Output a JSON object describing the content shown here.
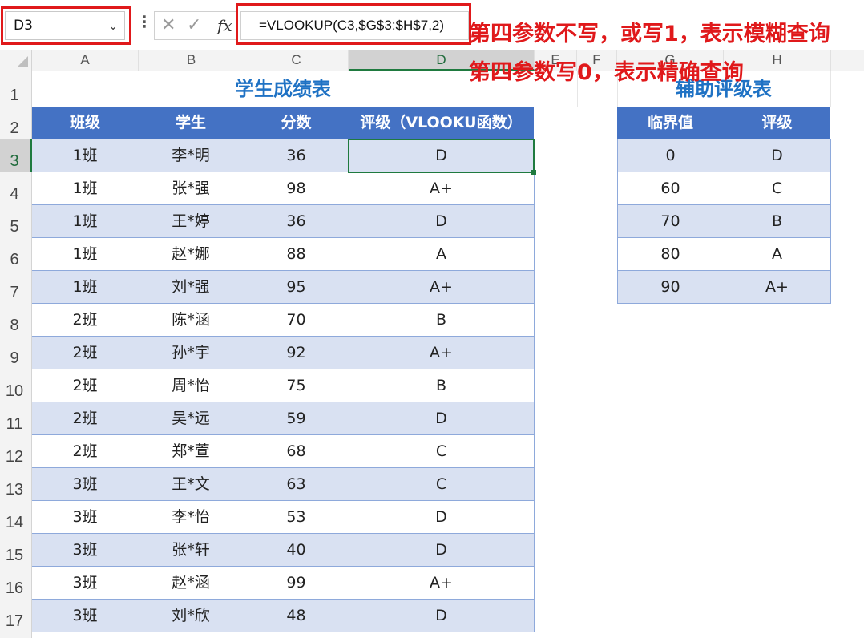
{
  "formula_bar": {
    "name_box": "D3",
    "formula": "=VLOOKUP(C3,$G$3:$H$7,2)",
    "fx_label": "fx"
  },
  "annotations": {
    "note1": "第四参数不写，或写1，表示模糊查询",
    "note2": "第四参数写0，表示精确查询"
  },
  "columns": [
    "A",
    "B",
    "C",
    "D",
    "E",
    "F",
    "G",
    "H"
  ],
  "rows": [
    "1",
    "2",
    "3",
    "4",
    "5",
    "6",
    "7",
    "8",
    "9",
    "10",
    "11",
    "12",
    "13",
    "14",
    "15",
    "16",
    "17"
  ],
  "score_table": {
    "title": "学生成绩表",
    "headers": [
      "班级",
      "学生",
      "分数",
      "评级（VLOOKU函数）"
    ],
    "rows": [
      [
        "1班",
        "李*明",
        "36",
        "D"
      ],
      [
        "1班",
        "张*强",
        "98",
        "A+"
      ],
      [
        "1班",
        "王*婷",
        "36",
        "D"
      ],
      [
        "1班",
        "赵*娜",
        "88",
        "A"
      ],
      [
        "1班",
        "刘*强",
        "95",
        "A+"
      ],
      [
        "2班",
        "陈*涵",
        "70",
        "B"
      ],
      [
        "2班",
        "孙*宇",
        "92",
        "A+"
      ],
      [
        "2班",
        "周*怡",
        "75",
        "B"
      ],
      [
        "2班",
        "吴*远",
        "59",
        "D"
      ],
      [
        "2班",
        "郑*萱",
        "68",
        "C"
      ],
      [
        "3班",
        "王*文",
        "63",
        "C"
      ],
      [
        "3班",
        "李*怡",
        "53",
        "D"
      ],
      [
        "3班",
        "张*轩",
        "40",
        "D"
      ],
      [
        "3班",
        "赵*涵",
        "99",
        "A+"
      ],
      [
        "3班",
        "刘*欣",
        "48",
        "D"
      ]
    ]
  },
  "grade_table": {
    "title": "辅助评级表",
    "headers": [
      "临界值",
      "评级"
    ],
    "rows": [
      [
        "0",
        "D"
      ],
      [
        "60",
        "C"
      ],
      [
        "70",
        "B"
      ],
      [
        "80",
        "A"
      ],
      [
        "90",
        "A+"
      ]
    ]
  },
  "colors": {
    "header_bg": "#4472c4",
    "band_bg": "#d9e1f2",
    "title_color": "#1f72c4",
    "annotation_red": "#e0191b",
    "selection_green": "#1f7a3f"
  }
}
